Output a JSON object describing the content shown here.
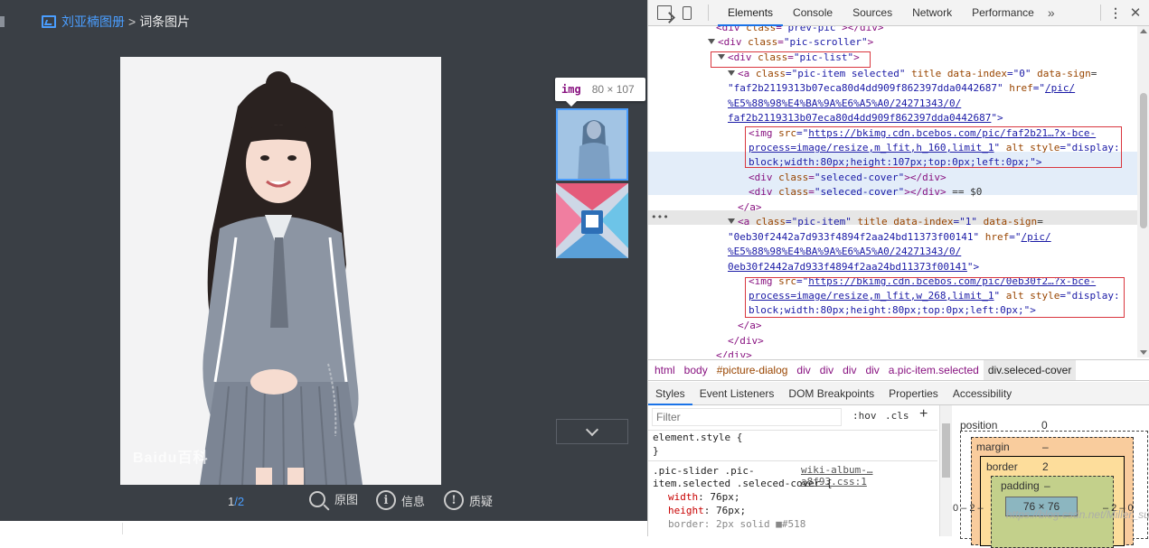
{
  "viewer": {
    "album_link": "刘亚楠图册",
    "separator": ">",
    "breadcrumb_current": "词条图片",
    "photo_watermark": "Baidu百科",
    "pager_current": "1",
    "pager_sep": "/",
    "pager_total": "2",
    "tools": {
      "original": "原图",
      "info_glyph": "i",
      "info": "信息",
      "report_glyph": "!",
      "report": "质疑"
    },
    "tooltip_tag": "img",
    "tooltip_dims": "80 × 107"
  },
  "devtools": {
    "tabs": [
      "Elements",
      "Console",
      "Sources",
      "Network",
      "Performance"
    ],
    "more_tabs": "»",
    "kebab": "⋮",
    "close": "✕",
    "lines": {
      "l0": {
        "pre": "<div ",
        "attr": "class",
        "val": "\"prev-pic\"",
        "post": "></div>"
      },
      "l1": {
        "pre": "<div ",
        "attr": "class",
        "val": "\"pic-scroller\"",
        "post": ">"
      },
      "l2": {
        "pre": "<div ",
        "attr": "class",
        "val": "\"pic-list\"",
        "post": ">"
      },
      "l3a": "<a ",
      "l3b": "class",
      "l3c": "=\"pic-item selected\" ",
      "l3d": "title data-index",
      "l3e": "=\"0\" ",
      "l3f": "data-sign",
      "l3g": "=",
      "l4a": "\"faf2b2119313b07eca80d4dd909f862397dda0442687\" ",
      "l4b": "href",
      "l4c": "=\"",
      "l4d": "/pic/",
      "l5": "%E5%88%98%E4%BA%9A%E6%A5%A0/24271343/0/",
      "l6a": "faf2b2119313b07eca80d4dd909f862397dda0442687",
      "l6b": "\">",
      "l7a": "<img ",
      "l7b": "src",
      "l7c": "=\"",
      "l7d": "https://bkimg.cdn.bcebos.com/pic/faf2b21…?x-bce-",
      "l8a": "process=image/resize,m_lfit,h_160,limit_1",
      "l8b": "\" ",
      "l8c": "alt style",
      "l8d": "=\"display:",
      "l9": "block;width:80px;height:107px;top:0px;left:0px;\">",
      "l10": {
        "pre": "<div ",
        "attr": "class",
        "val": "\"seleced-cover\"",
        "post": "></div>"
      },
      "l11": {
        "pre": "<div ",
        "attr": "class",
        "val": "\"seleced-cover\"",
        "post": "></div>",
        "suffix": " == $0"
      },
      "l12": "</a>",
      "l13a": "<a ",
      "l13b": "class",
      "l13c": "=\"pic-item\" ",
      "l13d": "title data-index",
      "l13e": "=\"1\" ",
      "l13f": "data-sign",
      "l13g": "=",
      "l14a": "\"0eb30f2442a7d933f4894f2aa24bd11373f00141\" ",
      "l14b": "href",
      "l14c": "=\"",
      "l14d": "/pic/",
      "l15": "%E5%88%98%E4%BA%9A%E6%A5%A0/24271343/0/",
      "l16a": "0eb30f2442a7d933f4894f2aa24bd11373f00141",
      "l16b": "\">",
      "l17a": "<img ",
      "l17b": "src",
      "l17c": "=\"",
      "l17d": "https://bkimg.cdn.bcebos.com/pic/0eb30f2…?x-bce-",
      "l18a": "process=image/resize,m_lfit,w_268,limit_1",
      "l18b": "\" ",
      "l18c": "alt style",
      "l18d": "=\"display:",
      "l19": "block;width:80px;height:80px;top:0px;left:0px;\">",
      "l20": "</a>",
      "l21": "</div>",
      "l22": "</div>"
    },
    "dots": "•••",
    "breadcrumbs": [
      "html",
      "body",
      "#picture-dialog",
      "div",
      "div",
      "div",
      "div",
      "a.pic-item.selected",
      "div.seleced-cover"
    ],
    "sub_tabs": [
      "Styles",
      "Event Listeners",
      "DOM Breakpoints",
      "Properties",
      "Accessibility"
    ],
    "styles": {
      "filter_placeholder": "Filter",
      "hov": ":hov",
      "cls": ".cls",
      "plus": "+",
      "element_style_open": "element.style {",
      "element_style_close": "}",
      "selector_1": ".pic-slider .pic-",
      "selector_2": "item.selected .seleced-cover {",
      "source": "wiki-album-…a8f93.css:1",
      "p1_name": "width",
      "p1_val": ": 76px;",
      "p2_name": "height",
      "p2_val": ": 76px;",
      "p3": "border: 2px solid ■#518"
    },
    "boxmodel": {
      "position_label": "position",
      "position_val": "0",
      "margin_label": "margin",
      "margin_val": "–",
      "border_label": "border",
      "border_val": "2",
      "padding_label": "padding",
      "padding_val": "–",
      "content": "76 × 76",
      "left_outer": "0 – 2 –",
      "right_outer": "– 2 – 0",
      "watermark_url": "https://blog.csdn.net/Miller_sun"
    }
  }
}
